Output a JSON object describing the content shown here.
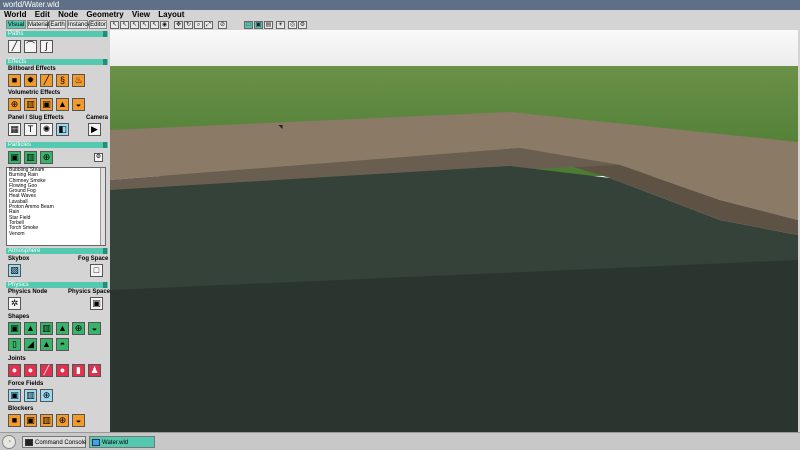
{
  "window": {
    "title": "world/Water.wld"
  },
  "menu": [
    "World",
    "Edit",
    "Node",
    "Geometry",
    "View",
    "Layout"
  ],
  "tabs": [
    "Visual",
    "Material",
    "Earth",
    "Instance",
    "Editor"
  ],
  "toolbar": {
    "left_icons": [
      "pointer-icon",
      "select-icon",
      "select-add-icon",
      "select-sub-icon",
      "select-intersect-icon",
      "eye-icon",
      "move-icon",
      "rotate-icon",
      "zoom-icon",
      "scale-icon",
      "hide-icon"
    ],
    "right_icons": [
      "view-icon",
      "object-icon",
      "material-icon",
      "light-icon",
      "camera-icon",
      "settings-icon"
    ]
  },
  "panels": {
    "paths": {
      "header": "Paths"
    },
    "effects": {
      "header": "Effects",
      "billboard_label": "Billboard Effects",
      "volumetric_label": "Volumetric Effects",
      "panel_slug_label": "Panel / Slug Effects",
      "camera_label": "Camera"
    },
    "particles": {
      "header": "Particles",
      "items": [
        "Bubbling Steam",
        "Burning Rain",
        "Chimney Smoke",
        "Flowing Goo",
        "Ground Fog",
        "Heat Waves",
        "Lavaball",
        "Proton Ammo Beam",
        "Rain",
        "Star Field",
        "Torbell",
        "Torch Smoke",
        "Venom"
      ]
    },
    "atmosphere": {
      "header": "Atmosphere",
      "skybox_label": "Skybox",
      "fogspace_label": "Fog Space"
    },
    "physics": {
      "header": "Physics",
      "node_label": "Physics Node",
      "space_label": "Physics Space",
      "shapes_label": "Shapes",
      "joints_label": "Joints",
      "force_label": "Force Fields",
      "blockers_label": "Blockers"
    }
  },
  "taskbar": {
    "items": [
      "Command Console",
      "Water.wld"
    ]
  },
  "colors": {
    "accent": "#55c8b0",
    "titlebar": "#5f6f86"
  }
}
